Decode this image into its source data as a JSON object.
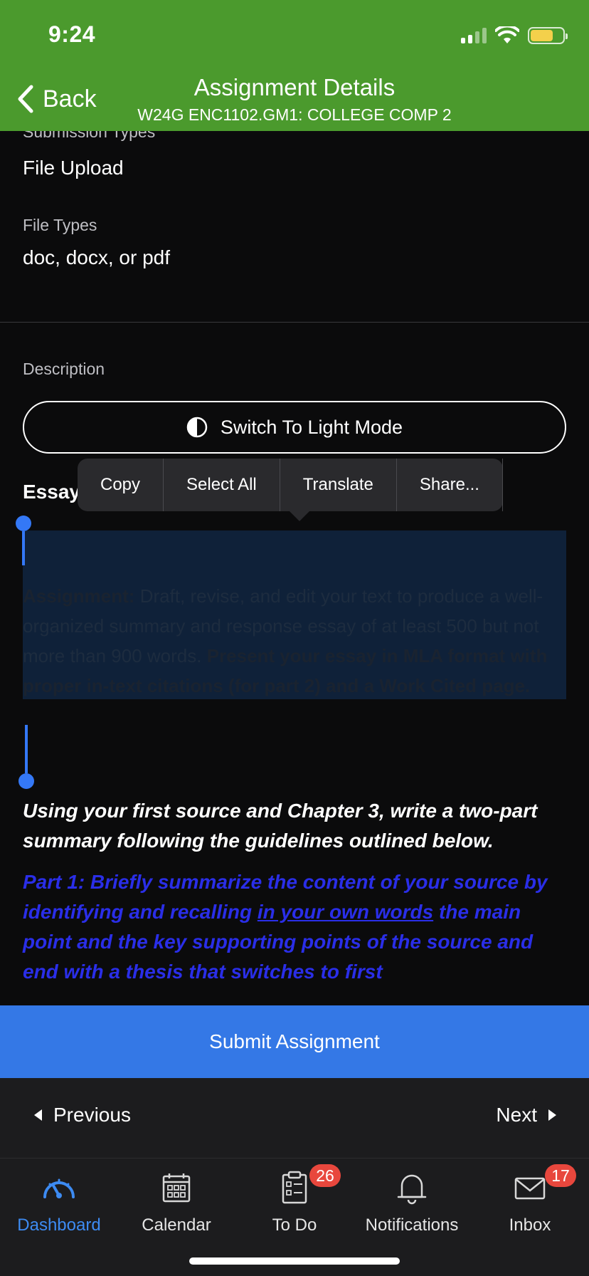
{
  "status_bar": {
    "time": "9:24"
  },
  "header": {
    "back_label": "Back",
    "title": "Assignment Details",
    "subtitle": "W24G ENC1102.GM1: COLLEGE COMP 2",
    "color": "#4b9a2d"
  },
  "details": {
    "submission_types_label": "Submission Types",
    "submission_types_value": "File Upload",
    "file_types_label": "File Types",
    "file_types_value": "doc, docx, or pdf",
    "description_label": "Description"
  },
  "mode_button": {
    "label": "Switch To Light Mode",
    "icon": "contrast-icon"
  },
  "essay": {
    "title": "Essay",
    "assignment_label": "Assignment:",
    "assignment_text": " Draft, revise, and edit your text to produce a well-organized summary and response essay of at least 500 but not more than 900 words. ",
    "assignment_bold": "Present your essay in MLA format with proper in-text citations (for part 2) and a Work Cited page.",
    "intro": "Using your first source and Chapter 3, write a two-part summary following the guidelines outlined below.",
    "part1_start": "Part 1: Briefly summarize the content of your source by identifying and recalling ",
    "part1_underlined": "in your own words",
    "part1_end": " the main point and the key supporting points of the source and end with a thesis that switches to first"
  },
  "context_menu": {
    "items": [
      "Copy",
      "Select All",
      "Translate",
      "Share..."
    ]
  },
  "submit": {
    "label": "Submit Assignment",
    "color": "#3478e6"
  },
  "pager": {
    "previous": "Previous",
    "next": "Next"
  },
  "tabs": [
    {
      "label": "Dashboard",
      "icon": "dashboard-gauge-icon",
      "active": true
    },
    {
      "label": "Calendar",
      "icon": "calendar-icon"
    },
    {
      "label": "To Do",
      "icon": "todo-clipboard-icon",
      "badge": "26"
    },
    {
      "label": "Notifications",
      "icon": "bell-icon"
    },
    {
      "label": "Inbox",
      "icon": "envelope-icon",
      "badge": "17"
    }
  ]
}
